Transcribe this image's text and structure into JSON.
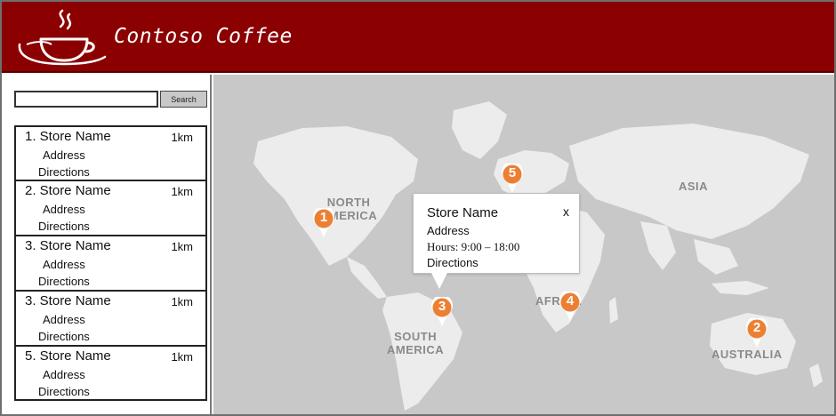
{
  "app": {
    "brand_name": "Contoso Coffee",
    "logo_icon": "coffee-cup-icon",
    "header_color": "#8b0000"
  },
  "search": {
    "placeholder": "",
    "value": "",
    "button_label": "Search"
  },
  "stores": [
    {
      "name": "1. Store Name",
      "distance": "1km",
      "address": "Address",
      "directions": "Directions"
    },
    {
      "name": "2. Store Name",
      "distance": "1km",
      "address": "Address",
      "directions": "Directions"
    },
    {
      "name": "3. Store Name",
      "distance": "1km",
      "address": "Address",
      "directions": "Directions"
    },
    {
      "name": "3. Store Name",
      "distance": "1km",
      "address": "Address",
      "directions": "Directions"
    },
    {
      "name": "5. Store Name",
      "distance": "1km",
      "address": "Address",
      "directions": "Directions"
    }
  ],
  "map": {
    "labels": {
      "north_america": "NORTH\nAMERICA",
      "south_america": "SOUTH\nAMERICA",
      "asia": "ASIA",
      "africa": "AFRICA",
      "australia": "AUSTRALIA"
    },
    "pins": [
      "1",
      "2",
      "3",
      "4",
      "5"
    ],
    "pin_color": "#ec8032",
    "popup": {
      "title": "Store Name",
      "close": "x",
      "address": "Address",
      "hours": "Hours: 9:00 – 18:00",
      "directions": "Directions"
    }
  }
}
